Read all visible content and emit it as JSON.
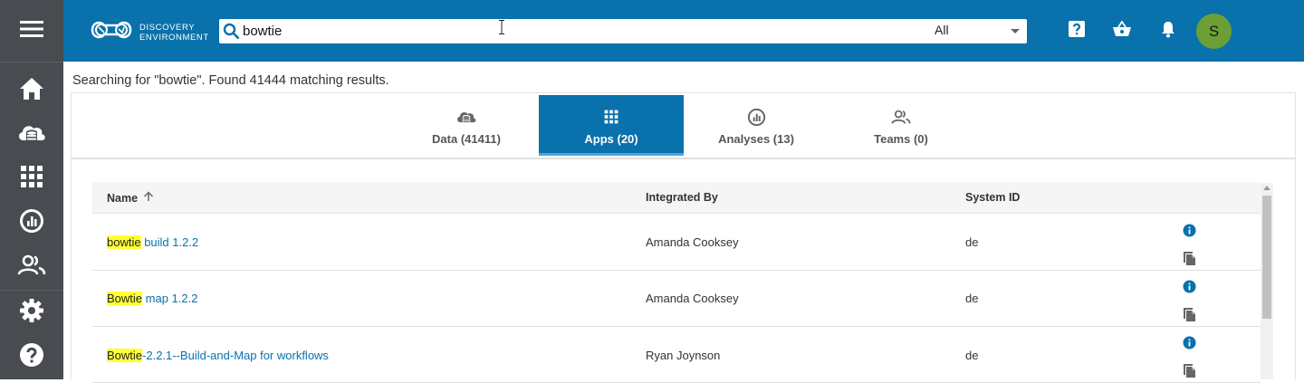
{
  "sidebar": {
    "menu_icon": "hamburger-menu-icon",
    "items": [
      {
        "name": "home",
        "icon": "home-icon"
      },
      {
        "name": "data",
        "icon": "cloud-database-icon"
      },
      {
        "name": "apps",
        "icon": "apps-grid-icon"
      },
      {
        "name": "analyses",
        "icon": "analyses-chart-icon"
      },
      {
        "name": "teams",
        "icon": "people-icon"
      },
      {
        "name": "settings",
        "icon": "gear-icon"
      },
      {
        "name": "help",
        "icon": "help-circle-icon"
      }
    ]
  },
  "header": {
    "logo_line1": "DISCOVERY",
    "logo_line2": "ENVIRONMENT",
    "search_value": "bowtie",
    "search_filter": "All",
    "icons": [
      "help-icon",
      "basket-icon",
      "bell-icon"
    ],
    "avatar_initial": "S"
  },
  "summary": "Searching for \"bowtie\". Found 41444 matching results.",
  "tabs": [
    {
      "label": "Data (41411)",
      "icon": "cloud-database-icon",
      "active": false
    },
    {
      "label": "Apps (20)",
      "icon": "apps-grid-icon",
      "active": true
    },
    {
      "label": "Analyses (13)",
      "icon": "analyses-chart-icon",
      "active": false
    },
    {
      "label": "Teams (0)",
      "icon": "people-icon",
      "active": false
    }
  ],
  "table": {
    "columns": {
      "name": "Name",
      "integrated_by": "Integrated By",
      "system_id": "System ID"
    },
    "rows": [
      {
        "highlight": "bowtie",
        "rest": " build 1.2.2",
        "integrated_by": "Amanda Cooksey",
        "system_id": "de"
      },
      {
        "highlight": "Bowtie",
        "rest": " map 1.2.2",
        "integrated_by": "Amanda Cooksey",
        "system_id": "de"
      },
      {
        "highlight": "Bowtie",
        "rest": "-2.2.1--Build-and-Map for workflows",
        "integrated_by": "Ryan Joynson",
        "system_id": "de"
      }
    ]
  },
  "colors": {
    "brand_blue": "#0971ab",
    "sidebar": "#484b4f",
    "highlight": "#ffff33",
    "avatar": "#6c9f38"
  }
}
